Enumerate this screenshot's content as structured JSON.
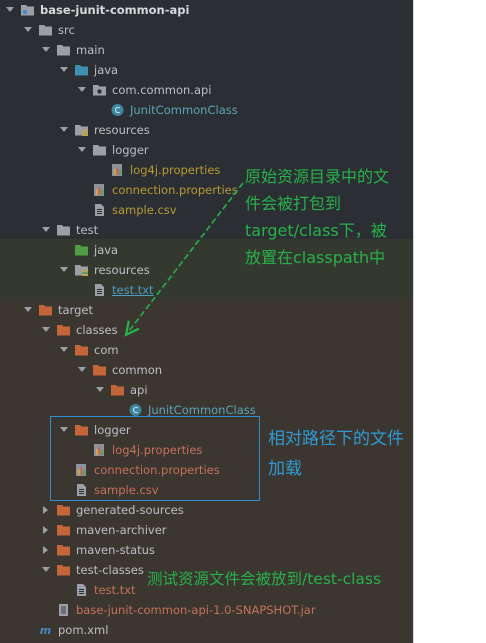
{
  "tree": [
    {
      "label": "base-junit-common-api",
      "style": "bold",
      "icon": "module-folder-icon",
      "arrow": "down",
      "depth": 0
    },
    {
      "label": "src",
      "style": "default",
      "icon": "folder-icon",
      "arrow": "down",
      "depth": 1
    },
    {
      "label": "main",
      "style": "default",
      "icon": "folder-icon",
      "arrow": "down",
      "depth": 2
    },
    {
      "label": "java",
      "style": "default",
      "icon": "source-root-icon",
      "arrow": "down",
      "depth": 3
    },
    {
      "label": "com.common.api",
      "style": "default",
      "icon": "package-icon",
      "arrow": "down",
      "depth": 4
    },
    {
      "label": "JunitCommonClass",
      "style": "src",
      "icon": "java-class-icon",
      "arrow": "none",
      "depth": 5
    },
    {
      "label": "resources",
      "style": "default",
      "icon": "resources-folder-icon",
      "arrow": "down",
      "depth": 3
    },
    {
      "label": "logger",
      "style": "default",
      "icon": "folder-icon",
      "arrow": "down",
      "depth": 4
    },
    {
      "label": "log4j.properties",
      "style": "res",
      "icon": "properties-file-icon",
      "arrow": "none",
      "depth": 5
    },
    {
      "label": "connection.properties",
      "style": "res",
      "icon": "properties-file-icon",
      "arrow": "none",
      "depth": 4
    },
    {
      "label": "sample.csv",
      "style": "res",
      "icon": "text-file-icon",
      "arrow": "none",
      "depth": 4
    },
    {
      "label": "test",
      "style": "default",
      "icon": "folder-icon",
      "arrow": "down",
      "depth": 2
    },
    {
      "label": "java",
      "style": "default",
      "icon": "test-source-root-icon",
      "arrow": "none",
      "depth": 3
    },
    {
      "label": "resources",
      "style": "default",
      "icon": "test-resources-folder-icon",
      "arrow": "down",
      "depth": 3
    },
    {
      "label": "test.txt",
      "style": "test",
      "icon": "text-file-icon",
      "arrow": "none",
      "depth": 4
    },
    {
      "label": "target",
      "style": "default",
      "icon": "excluded-folder-icon",
      "arrow": "down",
      "depth": 1
    },
    {
      "label": "classes",
      "style": "default",
      "icon": "excluded-folder-icon",
      "arrow": "down",
      "depth": 2
    },
    {
      "label": "com",
      "style": "default",
      "icon": "excluded-folder-icon",
      "arrow": "down",
      "depth": 3
    },
    {
      "label": "common",
      "style": "default",
      "icon": "excluded-folder-icon",
      "arrow": "down",
      "depth": 4
    },
    {
      "label": "api",
      "style": "default",
      "icon": "excluded-folder-icon",
      "arrow": "down",
      "depth": 5
    },
    {
      "label": "JunitCommonClass",
      "style": "src",
      "icon": "class-file-icon",
      "arrow": "none",
      "depth": 6
    },
    {
      "label": "logger",
      "style": "default",
      "icon": "excluded-folder-icon",
      "arrow": "down",
      "depth": 3
    },
    {
      "label": "log4j.properties",
      "style": "excl",
      "icon": "properties-file-icon",
      "arrow": "none",
      "depth": 4
    },
    {
      "label": "connection.properties",
      "style": "excl",
      "icon": "properties-file-icon",
      "arrow": "none",
      "depth": 3
    },
    {
      "label": "sample.csv",
      "style": "excl",
      "icon": "text-file-icon",
      "arrow": "none",
      "depth": 3
    },
    {
      "label": "generated-sources",
      "style": "default",
      "icon": "excluded-folder-icon",
      "arrow": "right",
      "depth": 2
    },
    {
      "label": "maven-archiver",
      "style": "default",
      "icon": "excluded-folder-icon",
      "arrow": "right",
      "depth": 2
    },
    {
      "label": "maven-status",
      "style": "default",
      "icon": "excluded-folder-icon",
      "arrow": "right",
      "depth": 2
    },
    {
      "label": "test-classes",
      "style": "default",
      "icon": "excluded-folder-icon",
      "arrow": "down",
      "depth": 2
    },
    {
      "label": "test.txt",
      "style": "excl",
      "icon": "text-file-icon",
      "arrow": "none",
      "depth": 3
    },
    {
      "label": "base-junit-common-api-1.0-SNAPSHOT.jar",
      "style": "excl",
      "icon": "jar-file-icon",
      "arrow": "none",
      "depth": 2
    },
    {
      "label": "pom.xml",
      "style": "default",
      "icon": "maven-pom-icon",
      "arrow": "none",
      "depth": 1
    }
  ],
  "annotations": {
    "resources_note": [
      "原始资源目录中的文",
      "件会被打包到",
      "target/class下，被",
      "放置在classpath中"
    ],
    "relative_path_note": [
      "相对路径下的文件",
      "加载"
    ],
    "test_resources_note": "测试资源文件会被放到/test-class"
  },
  "colors": {
    "panel": "#2b2f33",
    "test_band": "#34392f",
    "target_band": "#3b3630",
    "green_note": "#27b14a",
    "blue_note": "#2e9bd6"
  }
}
